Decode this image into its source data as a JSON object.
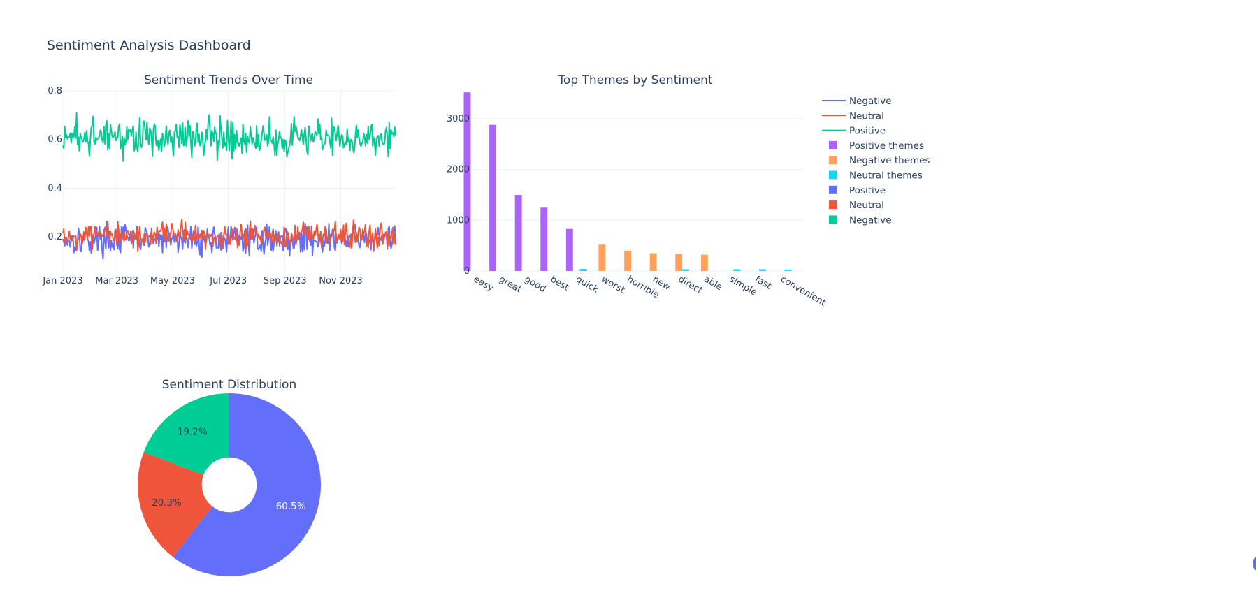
{
  "title": "Sentiment Analysis Dashboard",
  "colors": {
    "blue": "#636efa",
    "red": "#ef553b",
    "green": "#00cc96",
    "purple": "#ab63fa",
    "orange": "#ffa15a",
    "cyan": "#19d3f3"
  },
  "chart_data": [
    {
      "type": "line",
      "title": "Sentiment Trends Over Time",
      "x_ticks": [
        "Jan 2023",
        "Mar 2023",
        "May 2023",
        "Jul 2023",
        "Sep 2023",
        "Nov 2023"
      ],
      "x_range": [
        "2023-01-01",
        "2023-12-31"
      ],
      "y_ticks": [
        "0.2",
        "0.4",
        "0.6",
        "0.8"
      ],
      "ylim": [
        0.06,
        0.8
      ],
      "grid": true,
      "days": 365,
      "series": [
        {
          "name": "Negative",
          "color": "#636efa",
          "base": 0.19,
          "amplitude": 0.055,
          "min": 0.07,
          "max": 0.34
        },
        {
          "name": "Neutral",
          "color": "#ef553b",
          "base": 0.2,
          "amplitude": 0.05,
          "min": 0.1,
          "max": 0.39
        },
        {
          "name": "Positive",
          "color": "#00cc96",
          "base": 0.61,
          "amplitude": 0.07,
          "min": 0.37,
          "max": 0.77
        }
      ]
    },
    {
      "type": "bar",
      "title": "Top Themes by Sentiment",
      "categories": [
        "easy",
        "great",
        "good",
        "best",
        "quick",
        "worst",
        "horrible",
        "new",
        "direct",
        "able",
        "simple",
        "fast",
        "convenient"
      ],
      "y_ticks": [
        "0",
        "1000",
        "2000",
        "3000"
      ],
      "ylim": [
        0,
        3550
      ],
      "grid": true,
      "series": [
        {
          "name": "Positive themes",
          "color": "#ab63fa",
          "values": [
            3520,
            2880,
            1500,
            1250,
            830,
            null,
            null,
            null,
            null,
            null,
            null,
            null,
            null
          ]
        },
        {
          "name": "Negative themes",
          "color": "#ffa15a",
          "values": [
            null,
            null,
            null,
            null,
            null,
            520,
            400,
            350,
            330,
            320,
            null,
            null,
            null
          ]
        },
        {
          "name": "Neutral themes",
          "color": "#19d3f3",
          "values": [
            null,
            null,
            null,
            null,
            40,
            null,
            null,
            null,
            35,
            null,
            35,
            35,
            30
          ]
        }
      ]
    },
    {
      "type": "pie",
      "title": "Sentiment Distribution",
      "hole": 0.3,
      "slices": [
        {
          "name": "Positive",
          "value": 60.5,
          "label": "60.5%",
          "color": "#636efa",
          "text_color": "#ffffff"
        },
        {
          "name": "Neutral",
          "value": 20.3,
          "label": "20.3%",
          "color": "#ef553b",
          "text_color": "#2a3f5f"
        },
        {
          "name": "Negative",
          "value": 19.2,
          "label": "19.2%",
          "color": "#00cc96",
          "text_color": "#2a3f5f"
        }
      ]
    }
  ],
  "legend": {
    "placement": "right",
    "items": [
      {
        "label": "Negative",
        "kind": "line",
        "color": "#636efa"
      },
      {
        "label": "Neutral",
        "kind": "line",
        "color": "#ef553b"
      },
      {
        "label": "Positive",
        "kind": "line",
        "color": "#00cc96"
      },
      {
        "label": "Positive themes",
        "kind": "box",
        "color": "#ab63fa"
      },
      {
        "label": "Negative themes",
        "kind": "box",
        "color": "#ffa15a"
      },
      {
        "label": "Neutral themes",
        "kind": "box",
        "color": "#19d3f3"
      },
      {
        "label": "Positive",
        "kind": "box",
        "color": "#636efa"
      },
      {
        "label": "Neutral",
        "kind": "box",
        "color": "#ef553b"
      },
      {
        "label": "Negative",
        "kind": "box",
        "color": "#00cc96"
      }
    ]
  }
}
